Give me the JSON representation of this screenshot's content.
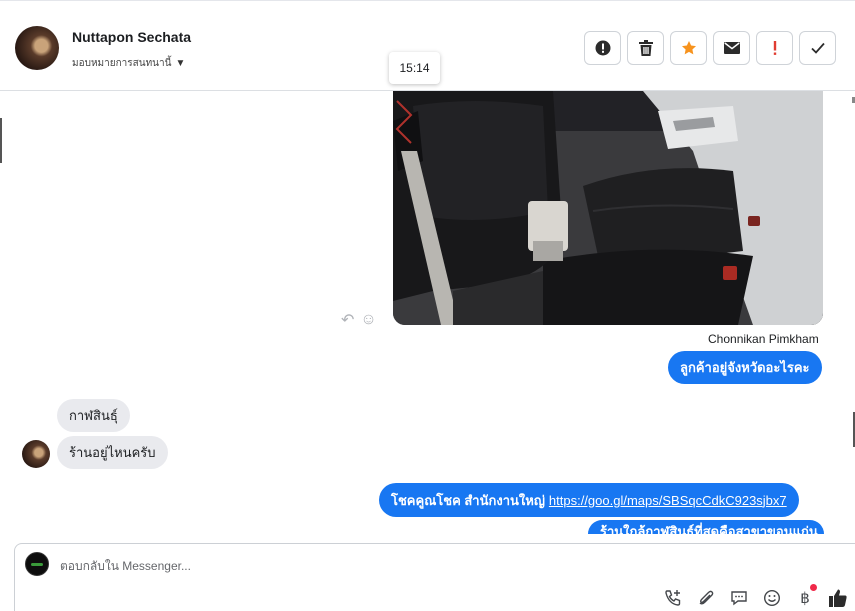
{
  "header": {
    "contact_name": "Nuttapon Sechata",
    "assign_label": "มอบหมายการสนทนานี้",
    "actions": [
      {
        "icon": "alert-circle-icon",
        "label": "!"
      },
      {
        "icon": "trash-icon",
        "label": ""
      },
      {
        "icon": "star-icon",
        "label": ""
      },
      {
        "icon": "envelope-icon",
        "label": ""
      },
      {
        "icon": "exclamation-icon",
        "label": "!"
      },
      {
        "icon": "check-icon",
        "label": ""
      }
    ]
  },
  "tooltip": {
    "time": "15:14"
  },
  "messages": {
    "sender_name": "Chonnikan Pimkham",
    "outgoing_1": "ลูกค้าอยู่จังหวัดอะไรคะ",
    "incoming_1": "กาฬสินธุ์",
    "incoming_2": "ร้านอยู่ไหนครับ",
    "outgoing_2_text": "โชคคูณโชค สำนักงานใหญ่",
    "outgoing_2_link": "https://goo.gl/maps/SBSqcCdkC923sjbx7",
    "outgoing_3_partial": "ร้านใกล้กาฬสินธุ์ที่สุดคือสาขาขอนแก่น"
  },
  "composer": {
    "placeholder": "ตอบกลับใน Messenger...",
    "baht_symbol": "฿"
  },
  "colors": {
    "accent_blue": "#1877f2",
    "star_orange": "#f7931e",
    "alert_red": "#e03c31",
    "incoming_bubble": "#e9eaee"
  }
}
